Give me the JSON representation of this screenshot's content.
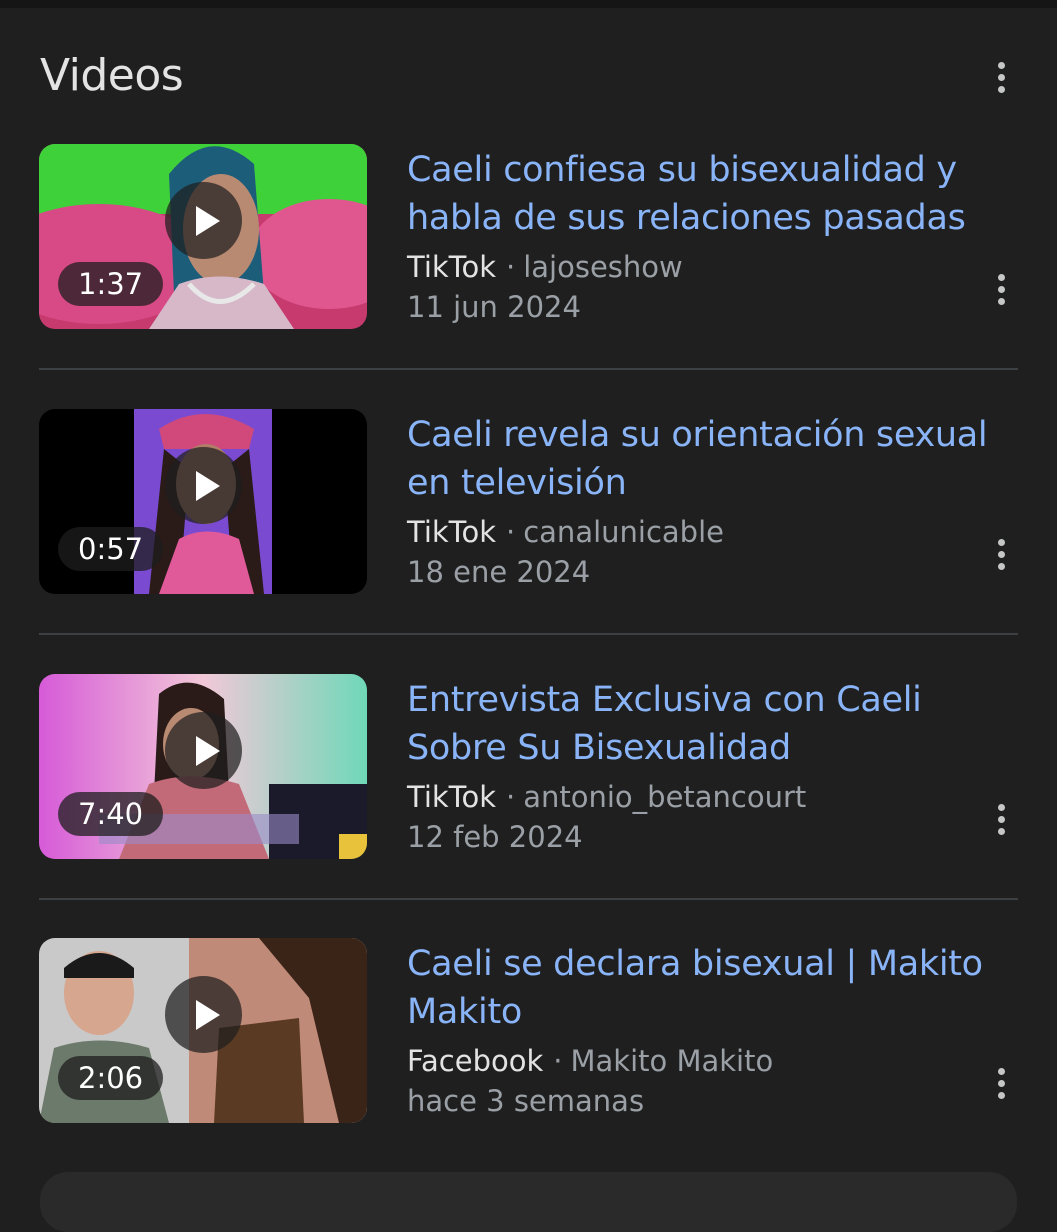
{
  "section": {
    "title": "Videos",
    "more_icon": "more-vert-icon"
  },
  "videos": [
    {
      "title": "Caeli confiesa su bisexualidad y habla de sus relaciones pasadas",
      "duration": "1:37",
      "source": "TikTok",
      "separator": "·",
      "channel": "lajoseshow",
      "date": "11 jun 2024"
    },
    {
      "title": "Caeli revela su orientación sexual en televisión",
      "duration": "0:57",
      "source": "TikTok",
      "separator": "·",
      "channel": "canalunicable",
      "date": "18 ene 2024"
    },
    {
      "title": "Entrevista Exclusiva con Caeli Sobre Su Bisexualidad",
      "duration": "7:40",
      "source": "TikTok",
      "separator": "·",
      "channel": "antonio_betancourt",
      "date": "12 feb 2024"
    },
    {
      "title": "Caeli se declara bisexual | Makito Makito",
      "duration": "2:06",
      "source": "Facebook",
      "separator": "·",
      "channel": "Makito Makito",
      "date": "hace 3 semanas"
    }
  ],
  "colors": {
    "background": "#1f1f1f",
    "title_link": "#8ab4f8",
    "secondary_text": "#9aa0a6",
    "divider": "#3c4043"
  }
}
